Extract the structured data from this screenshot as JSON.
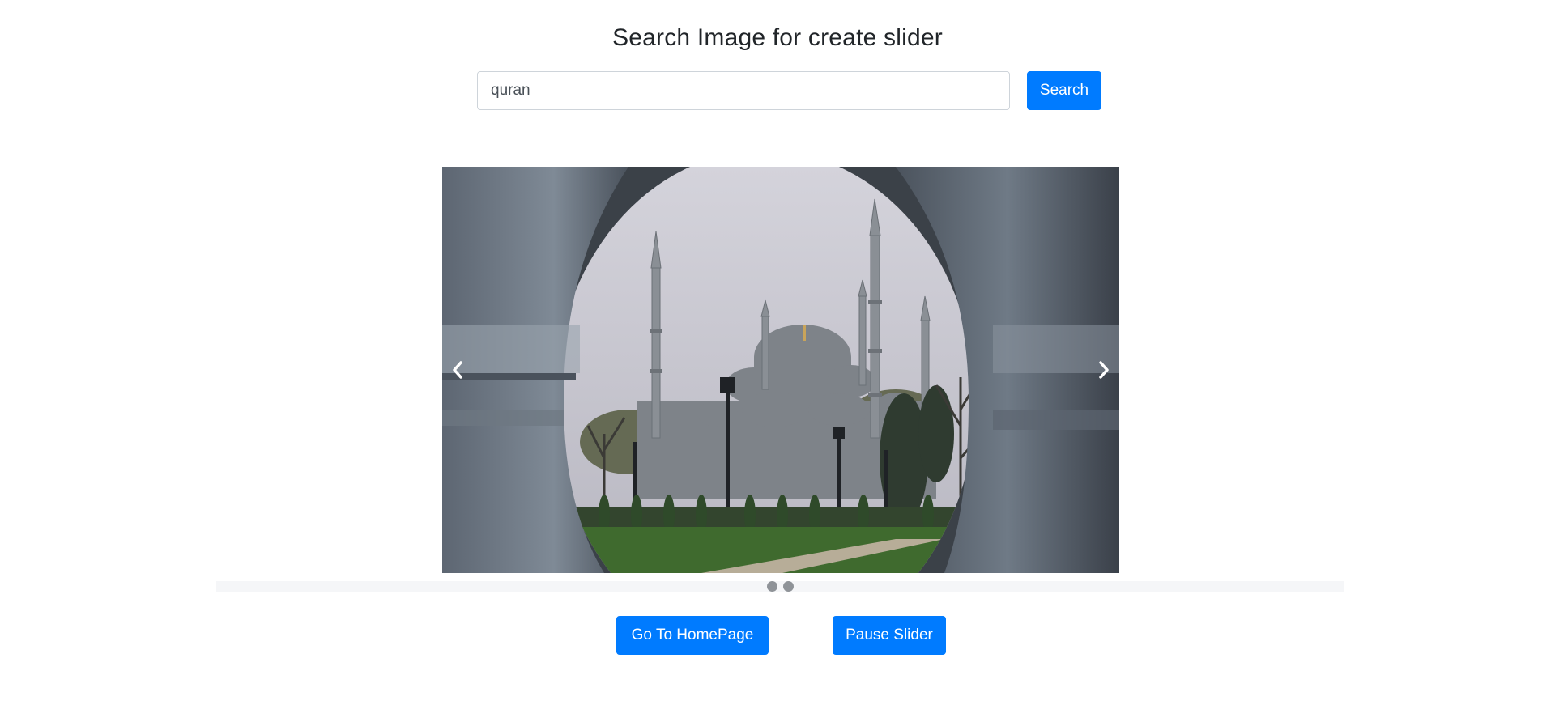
{
  "header": {
    "title": "Search Image for create slider"
  },
  "search": {
    "value": "quran",
    "button_label": "Search"
  },
  "slider": {
    "slide_count": 2,
    "active_index": 0,
    "prev_icon": "chevron-left-icon",
    "next_icon": "chevron-right-icon",
    "image_subject": "mosque with minarets viewed through a circular opening"
  },
  "actions": {
    "home_label": "Go To HomePage",
    "pause_label": "Pause Slider"
  },
  "colors": {
    "primary": "#007bff",
    "dot": "#8f9398",
    "title_text": "#212529"
  }
}
